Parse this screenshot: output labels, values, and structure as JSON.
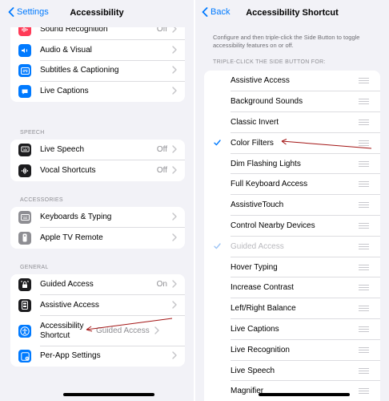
{
  "left": {
    "nav": {
      "back_label": "Settings",
      "title": "Accessibility"
    },
    "top_items": [
      {
        "label": "Sound Recognition",
        "value": "Off",
        "color": "#ff3b57",
        "icon": "waveform-ear-icon"
      },
      {
        "label": "Audio & Visual",
        "value": "",
        "color": "#007aff",
        "icon": "speaker-eye-icon"
      },
      {
        "label": "Subtitles & Captioning",
        "value": "",
        "color": "#007aff",
        "icon": "captions-icon"
      },
      {
        "label": "Live Captions",
        "value": "",
        "color": "#007aff",
        "icon": "speech-bubble-icon"
      }
    ],
    "speech": {
      "header": "SPEECH",
      "items": [
        {
          "label": "Live Speech",
          "value": "Off",
          "color": "#1c1c1e",
          "icon": "keyboard-bubble-icon"
        },
        {
          "label": "Vocal Shortcuts",
          "value": "Off",
          "color": "#1c1c1e",
          "icon": "waveform-icon"
        }
      ]
    },
    "accessories": {
      "header": "ACCESSORIES",
      "items": [
        {
          "label": "Keyboards & Typing",
          "value": "",
          "color": "#8e8e93",
          "icon": "keyboard-icon"
        },
        {
          "label": "Apple TV Remote",
          "value": "",
          "color": "#8e8e93",
          "icon": "remote-icon"
        }
      ]
    },
    "general": {
      "header": "GENERAL",
      "items": [
        {
          "label": "Guided Access",
          "value": "On",
          "color": "#1c1c1e",
          "icon": "lock-icon"
        },
        {
          "label": "Assistive Access",
          "value": "",
          "color": "#1c1c1e",
          "icon": "assistive-icon"
        },
        {
          "label": "Accessibility Shortcut",
          "value": "Guided Access",
          "color": "#007aff",
          "icon": "accessibility-icon"
        },
        {
          "label": "Per-App Settings",
          "value": "",
          "color": "#007aff",
          "icon": "apps-icon"
        }
      ]
    }
  },
  "right": {
    "nav": {
      "back_label": "Back",
      "title": "Accessibility Shortcut"
    },
    "description": "Configure and then triple-click the Side Button to toggle accessibility features on or off.",
    "section_header": "TRIPLE-CLICK THE SIDE BUTTON FOR:",
    "items": [
      {
        "label": "Assistive Access",
        "checked": false,
        "dim": false
      },
      {
        "label": "Background Sounds",
        "checked": false,
        "dim": false
      },
      {
        "label": "Classic Invert",
        "checked": false,
        "dim": false
      },
      {
        "label": "Color Filters",
        "checked": true,
        "dim": false
      },
      {
        "label": "Dim Flashing Lights",
        "checked": false,
        "dim": false
      },
      {
        "label": "Full Keyboard Access",
        "checked": false,
        "dim": false
      },
      {
        "label": "AssistiveTouch",
        "checked": false,
        "dim": false
      },
      {
        "label": "Control Nearby Devices",
        "checked": false,
        "dim": false
      },
      {
        "label": "Guided Access",
        "checked": true,
        "dim": true
      },
      {
        "label": "Hover Typing",
        "checked": false,
        "dim": false
      },
      {
        "label": "Increase Contrast",
        "checked": false,
        "dim": false
      },
      {
        "label": "Left/Right Balance",
        "checked": false,
        "dim": false
      },
      {
        "label": "Live Captions",
        "checked": false,
        "dim": false
      },
      {
        "label": "Live Recognition",
        "checked": false,
        "dim": false
      },
      {
        "label": "Live Speech",
        "checked": false,
        "dim": false
      },
      {
        "label": "Magnifier",
        "checked": false,
        "dim": false
      }
    ]
  },
  "colors": {
    "accent": "#007aff",
    "annotation": "#a31515"
  }
}
